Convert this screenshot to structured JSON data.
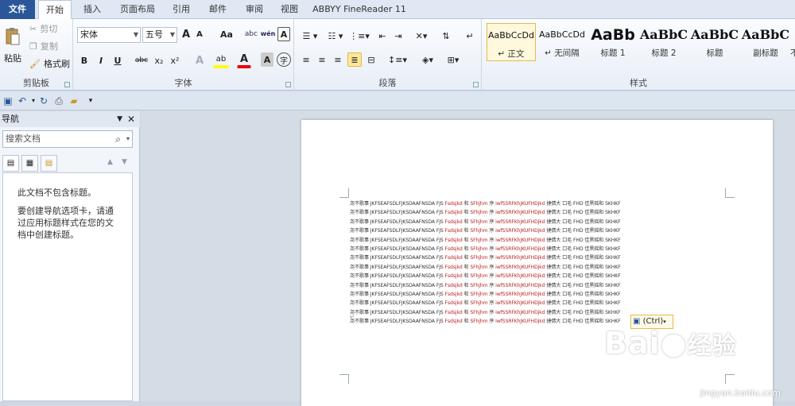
{
  "tabs": [
    "文件",
    "开始",
    "插入",
    "页面布局",
    "引用",
    "邮件",
    "审阅",
    "视图",
    "ABBYY FineReader 11"
  ],
  "ribbon": {
    "clipboard": {
      "label": "剪贴板",
      "paste": "粘贴",
      "cut": "剪切",
      "copy": "复制",
      "format_painter": "格式刷"
    },
    "font": {
      "label": "字体",
      "font_name": "宋体",
      "font_size": "五号",
      "grow": "A",
      "shrink": "A",
      "change_case": "Aa",
      "clear": "abc",
      "pinyin": "wén",
      "char_border": "A",
      "bold": "B",
      "italic": "I",
      "underline": "U",
      "strike": "abc",
      "sub": "x₂",
      "sup": "x²",
      "effects": "A",
      "highlight": "ab",
      "color": "A",
      "shade": "A",
      "enclose": "字"
    },
    "paragraph": {
      "label": "段落"
    },
    "styles": {
      "label": "样式",
      "items": [
        {
          "sample": "AaBbCcDd",
          "caption": "↵ 正文",
          "active": true
        },
        {
          "sample": "AaBbCcDd",
          "caption": "↵ 无间隔",
          "active": false
        },
        {
          "sample": "AaBb",
          "caption": "标题 1",
          "active": false
        },
        {
          "sample": "AaBbC",
          "caption": "标题 2",
          "active": false
        },
        {
          "sample": "AaBbC",
          "caption": "标题",
          "active": false
        },
        {
          "sample": "AaBbC",
          "caption": "副标题",
          "active": false
        },
        {
          "sample": "",
          "caption": "不",
          "active": false
        }
      ]
    }
  },
  "nav": {
    "title": "导航",
    "search_placeholder": "搜索文档",
    "msg1": "此文档不包含标题。",
    "msg2": "要创建导航选项卡，请通过应用标题样式在您的文档中创建标题。"
  },
  "document": {
    "line_prefix": "尧不歌事 JKFSEAFSDLFJKSDAAFNSDA FJS ",
    "line_red1": "Fsdsjkd",
    "line_mid": " 和 ",
    "line_red2": "SFhjhm",
    "line_mid2": " 序 ",
    "line_red3": "iwfSSRFKhJKUFHDjkd",
    "line_suffix": " 捷倩大 口毛 FHD 佳黑摇和 SKHKF",
    "line_count": 14,
    "paste_label": "(Ctrl)"
  },
  "watermark": {
    "brand": "Bai",
    "brand2": "经验",
    "url": "jingyan.baidu.com"
  }
}
